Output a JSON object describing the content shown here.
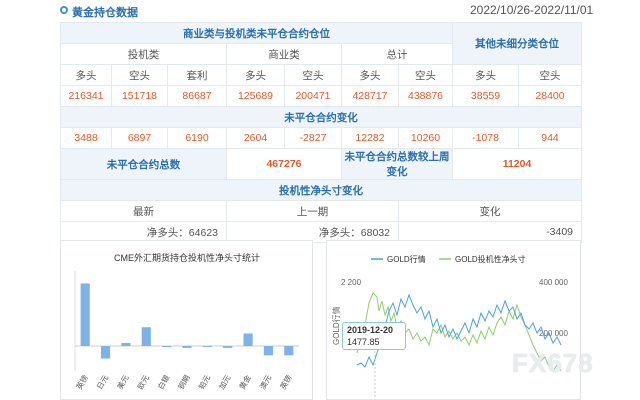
{
  "header": {
    "title": "黄金持仓数据",
    "date_range": "2022/10/26-2022/11/01"
  },
  "table": {
    "h_commercial_noncommercial": "商业类与投机类未平仓合约仓位",
    "h_other": "其他未细分类仓位",
    "h_spec": "投机类",
    "h_comm": "商业类",
    "h_total": "总计",
    "long": "多头",
    "short": "空头",
    "spread": "套利",
    "values": [
      "216341",
      "151718",
      "86687",
      "125689",
      "200471",
      "428717",
      "438876",
      "38559",
      "28400"
    ],
    "h_change": "未平仓合约变化",
    "changes": [
      "3488",
      "6897",
      "6190",
      "2604",
      "-2827",
      "12282",
      "10260",
      "-1078",
      "944"
    ],
    "oi_total_label": "未平仓合约总数",
    "oi_total": "467276",
    "oi_week_label": "未平仓合约总数较上周变化",
    "oi_week": "11204",
    "h_net": "投机性净头寸变化",
    "latest": "最新",
    "previous": "上一期",
    "delta": "变化",
    "net_latest": "净多头：64623",
    "net_prev": "净多头：68032",
    "net_delta": "-3409"
  },
  "chart_data": [
    {
      "type": "bar",
      "title": "CME外汇期货持仓投机性净头寸统计",
      "categories": [
        "英镑",
        "日元",
        "美元",
        "欧元",
        "白银",
        "铜期",
        "铂元",
        "加元",
        "黄金",
        "澳元",
        "英镑"
      ],
      "values": [
        100,
        -20,
        5,
        30,
        0,
        -3,
        0,
        -3,
        20,
        -15,
        -15
      ],
      "ylim": [
        -40,
        120
      ],
      "colors": [
        "#7fb2e6"
      ]
    },
    {
      "type": "line",
      "series": [
        {
          "name": "GOLD行情",
          "color": "#4aa3df"
        },
        {
          "name": "GOLD投机性净头寸",
          "color": "#8fce6a"
        }
      ],
      "y_left_ticks": [
        "2 200"
      ],
      "y_left_label": "GOLD行情",
      "y_right_ticks": [
        "400 000",
        "200 000"
      ],
      "tooltip_date": "2019-12-20",
      "tooltip_value": "1477.85"
    }
  ],
  "watermark": "FX678"
}
